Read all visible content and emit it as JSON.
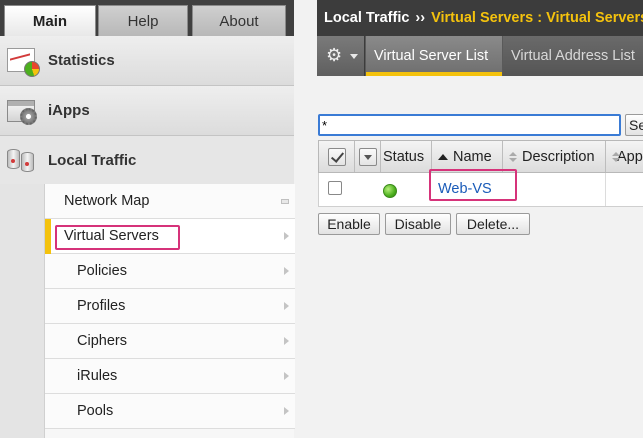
{
  "nav_tabs": [
    {
      "label": "Main",
      "active": true
    },
    {
      "label": "Help",
      "active": false
    },
    {
      "label": "About",
      "active": false
    }
  ],
  "sections": {
    "statistics": {
      "label": "Statistics",
      "icon": "statistics-chart-icon"
    },
    "iapps": {
      "label": "iApps",
      "icon": "iapps-gear-icon"
    },
    "local_traffic": {
      "label": "Local Traffic",
      "icon": "local-traffic-servers-icon"
    }
  },
  "submenu": {
    "items": [
      {
        "label": "Network Map"
      },
      {
        "label": "Virtual Servers",
        "selected": true
      },
      {
        "label": "Policies"
      },
      {
        "label": "Profiles"
      },
      {
        "label": "Ciphers"
      },
      {
        "label": "iRules"
      },
      {
        "label": "Pools"
      }
    ]
  },
  "breadcrumb": {
    "root": "Local Traffic",
    "separator": "››",
    "current": "Virtual Servers : Virtual Servers"
  },
  "content_tabs": [
    {
      "label": "Virtual Server List",
      "active": true
    },
    {
      "label": "Virtual Address List",
      "active": false
    }
  ],
  "search": {
    "value": "*",
    "button_label": "Search"
  },
  "table": {
    "columns": [
      "Status",
      "Name",
      "Description",
      "Application"
    ],
    "rows": [
      {
        "status": "available",
        "status_color": "#4caf1e",
        "name": "Web-VS",
        "description": ""
      }
    ]
  },
  "actions": {
    "enable": "Enable",
    "disable": "Disable",
    "delete": "Delete..."
  },
  "colors": {
    "accent_yellow": "#f4c20d",
    "link_blue": "#1a5bb8",
    "highlight_pink": "#d6337a",
    "status_green": "#4caf1e"
  }
}
